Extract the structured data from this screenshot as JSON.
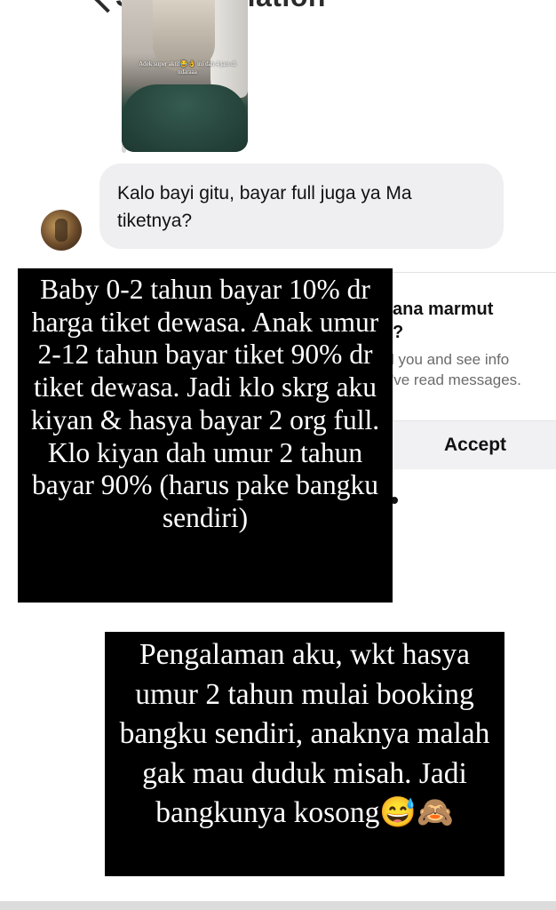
{
  "header": {
    "see_translation_label": "See translation"
  },
  "story_reply": {
    "caption": "Adek super aktif😂👌 ini dah 4 jam di udaraaa"
  },
  "message": {
    "text": "Kalo bayi gitu, bayar full juga ya Ma tiketnya?"
  },
  "request_card": {
    "title_partial": "ana marmut",
    "title_line2": "?",
    "info_line1": "l you and see info",
    "info_line2": "'ve read messages.",
    "accept_label": "Accept"
  },
  "overlay_1": {
    "text": "Baby 0-2 tahun bayar 10% dr harga tiket dewasa. Anak umur 2-12 tahun bayar tiket 90% dr tiket dewasa. Jadi klo skrg aku kiyan & hasya bayar 2 org full. Klo kiyan dah umur 2 tahun bayar 90% (harus pake bangku sendiri)"
  },
  "overlay_2": {
    "text": "Pengalaman aku, wkt hasya umur 2 tahun mulai booking bangku sendiri, anaknya malah gak mau duduk misah. Jadi bangkunya kosong😅🙈"
  },
  "colors": {
    "bubble_bg": "#efeff1",
    "overlay_bg": "#000000",
    "overlay_text": "#ffffff"
  }
}
